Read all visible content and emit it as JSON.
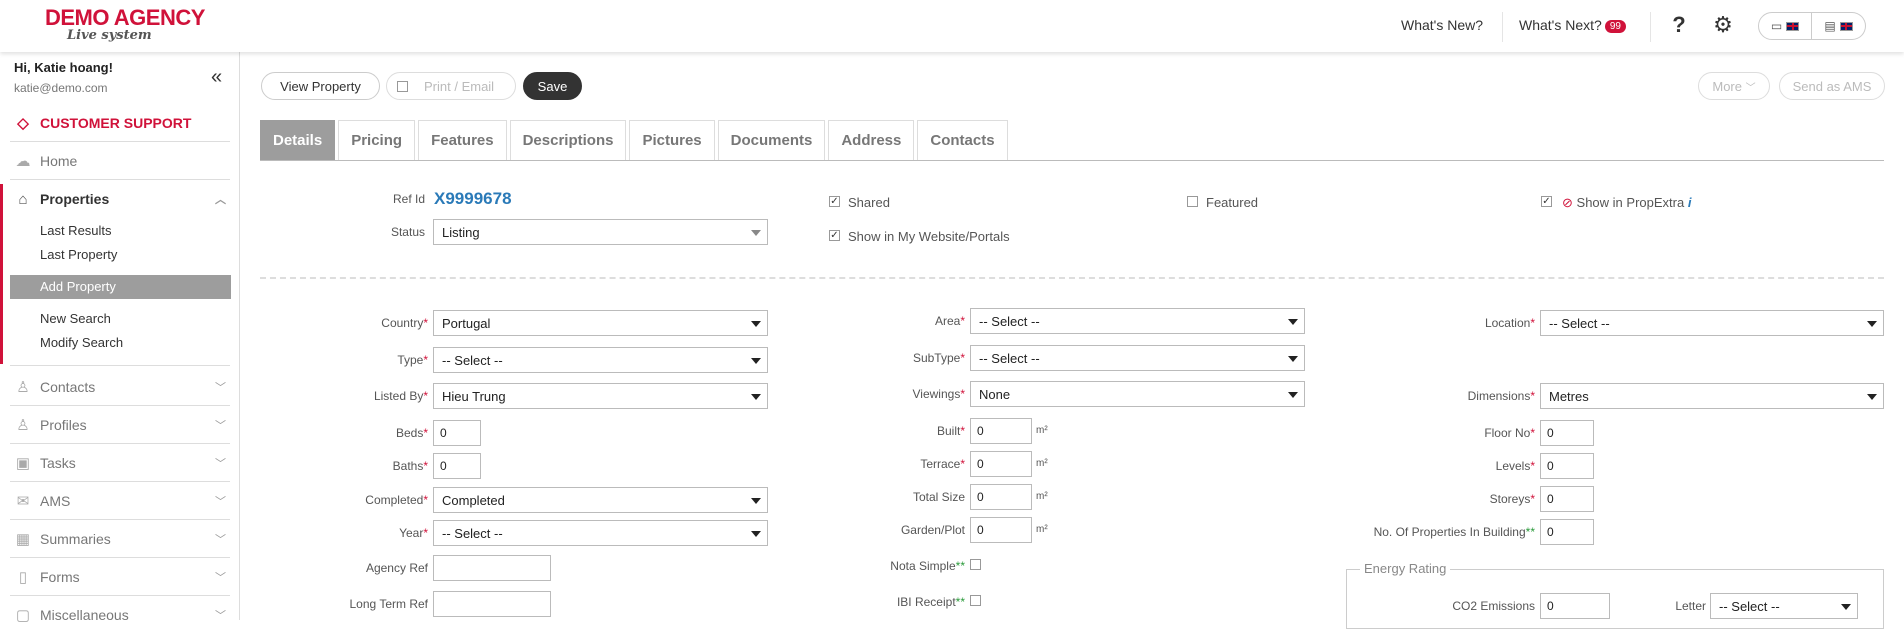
{
  "header": {
    "logo_line1": "DEMO AGENCY",
    "logo_line2": "Live system",
    "whats_new": "What's New?",
    "whats_next": "What's Next?",
    "whats_next_count": "99",
    "help_icon": "question-icon",
    "settings_icon": "gear-icon",
    "accent_color": "#d0123a"
  },
  "sidebar": {
    "greeting": "Hi, Katie hoang!",
    "email": "katie@demo.com",
    "support": "CUSTOMER SUPPORT",
    "home": "Home",
    "properties": "Properties",
    "sub": [
      "Last Results",
      "Last Property",
      "Add Property",
      "New Search",
      "Modify Search"
    ],
    "items": [
      "Contacts",
      "Profiles",
      "Tasks",
      "AMS",
      "Summaries",
      "Forms",
      "Miscellaneous"
    ]
  },
  "toolbar": {
    "view_property": "View Property",
    "print_email": "Print / Email",
    "save": "Save",
    "more": "More",
    "send_ams": "Send as AMS"
  },
  "tabs": [
    "Details",
    "Pricing",
    "Features",
    "Descriptions",
    "Pictures",
    "Documents",
    "Address",
    "Contacts"
  ],
  "details": {
    "ref_id_label": "Ref Id",
    "ref_id": "X9999678",
    "status_label": "Status",
    "status": "Listing",
    "shared": "Shared",
    "show_website": "Show in My Website/Portals",
    "featured": "Featured",
    "show_propextra": "Show in PropExtra"
  },
  "form": {
    "country_label": "Country",
    "country": "Portugal",
    "type_label": "Type",
    "type": "-- Select --",
    "listed_by_label": "Listed By",
    "listed_by": "Hieu Trung",
    "beds_label": "Beds",
    "beds": "0",
    "baths_label": "Baths",
    "baths": "0",
    "completed_label": "Completed",
    "completed": "Completed",
    "year_label": "Year",
    "year": "-- Select --",
    "agency_ref_label": "Agency Ref",
    "long_term_ref_label": "Long Term Ref",
    "area_label": "Area",
    "area": "-- Select --",
    "subtype_label": "SubType",
    "subtype": "-- Select --",
    "viewings_label": "Viewings",
    "viewings": "None",
    "built_label": "Built",
    "built": "0",
    "terrace_label": "Terrace",
    "terrace": "0",
    "total_size_label": "Total Size",
    "total_size": "0",
    "garden_label": "Garden/Plot",
    "garden": "0",
    "unit": "m²",
    "nota_simple_label": "Nota Simple",
    "ibi_receipt_label": "IBI Receipt",
    "location_label": "Location",
    "location": "-- Select --",
    "dimensions_label": "Dimensions",
    "dimensions": "Metres",
    "floor_no_label": "Floor No",
    "floor_no": "0",
    "levels_label": "Levels",
    "levels": "0",
    "storeys_label": "Storeys",
    "storeys": "0",
    "no_props_label": "No. Of Properties In Building",
    "no_props": "0",
    "energy_rating": "Energy Rating",
    "co2_label": "CO2 Emissions",
    "co2": "0",
    "letter_label": "Letter",
    "letter": "-- Select --"
  }
}
